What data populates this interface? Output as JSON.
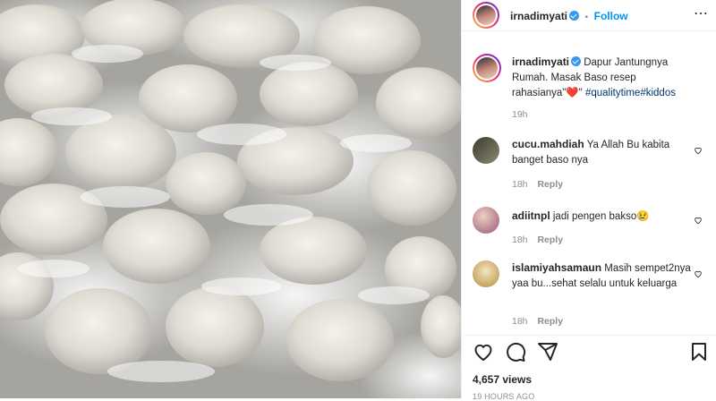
{
  "post": {
    "username": "irnadimyati",
    "follow_separator": "•",
    "follow_label": "Follow",
    "more_label": "⋯"
  },
  "caption": {
    "username": "irnadimyati",
    "text": "Dapur Jantungnya Rumah. Masak Baso resep rahasianya\"",
    "emoji": "❤️",
    "quote_after": "\"",
    "hashtags": "#qualitytime#kiddos",
    "time": "19h"
  },
  "comments": [
    {
      "username": "cucu.mahdiah",
      "text": "Ya Allah Bu kabita banget baso nya",
      "time": "18h",
      "reply": "Reply"
    },
    {
      "username": "adiitnpl",
      "text": "jadi pengen bakso",
      "emoji": "😢",
      "time": "18h",
      "reply": "Reply"
    },
    {
      "username": "islamiyahsamaun",
      "text": "Masih sempet2nya yaa bu...sehat selalu untuk keluarga",
      "time": "18h",
      "reply": "Reply"
    }
  ],
  "stats": {
    "views": "4,657 views",
    "timestamp": "19 HOURS AGO"
  },
  "icons": {
    "like": "heart-icon",
    "comment": "comment-icon",
    "share": "share-icon",
    "save": "bookmark-icon"
  },
  "colors": {
    "accent": "#0095f6",
    "hashtag": "#00376b",
    "heart": "#ed4956"
  }
}
